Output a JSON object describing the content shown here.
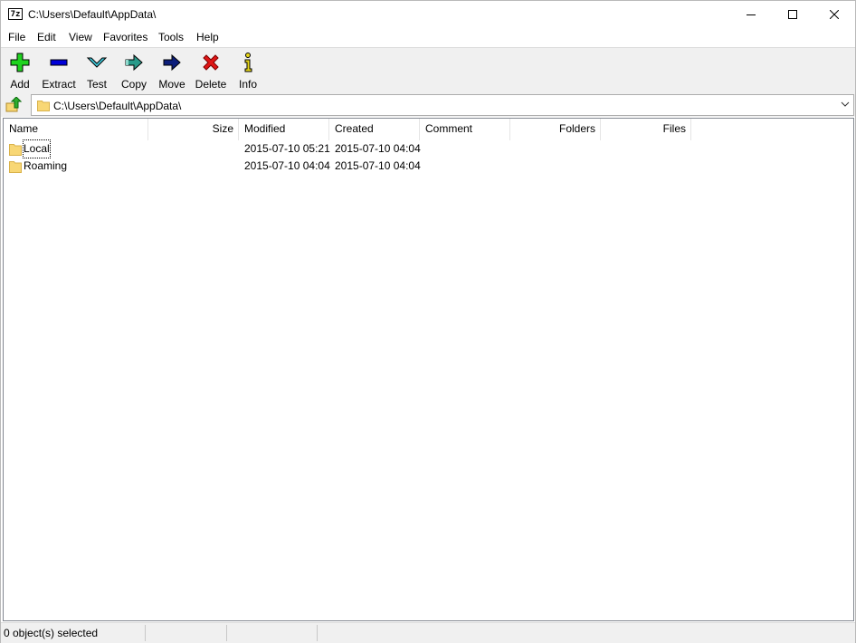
{
  "window": {
    "title": "C:\\Users\\Default\\AppData\\",
    "app_icon_text": "7z"
  },
  "menu": [
    "File",
    "Edit",
    "View",
    "Favorites",
    "Tools",
    "Help"
  ],
  "toolbar": [
    {
      "label": "Add",
      "icon": "add-icon"
    },
    {
      "label": "Extract",
      "icon": "extract-icon"
    },
    {
      "label": "Test",
      "icon": "test-icon"
    },
    {
      "label": "Copy",
      "icon": "copy-icon"
    },
    {
      "label": "Move",
      "icon": "move-icon"
    },
    {
      "label": "Delete",
      "icon": "delete-icon"
    },
    {
      "label": "Info",
      "icon": "info-icon"
    }
  ],
  "address": {
    "path": "C:\\Users\\Default\\AppData\\"
  },
  "columns": [
    "Name",
    "Size",
    "Modified",
    "Created",
    "Comment",
    "Folders",
    "Files"
  ],
  "rows": [
    {
      "name": "Local",
      "size": "",
      "modified": "2015-07-10 05:21",
      "created": "2015-07-10 04:04",
      "comment": "",
      "folders": "",
      "files": ""
    },
    {
      "name": "Roaming",
      "size": "",
      "modified": "2015-07-10 04:04",
      "created": "2015-07-10 04:04",
      "comment": "",
      "folders": "",
      "files": ""
    }
  ],
  "status": {
    "selected": "0 object(s) selected"
  },
  "colors": {
    "folder": "#f8d775",
    "add": "#1fd31f",
    "extract": "#0000d8",
    "test": "#3fc6d8",
    "copy": "#2a9a8a",
    "move": "#0c1e7a",
    "delete": "#e01616",
    "info": "#e8d81a"
  }
}
